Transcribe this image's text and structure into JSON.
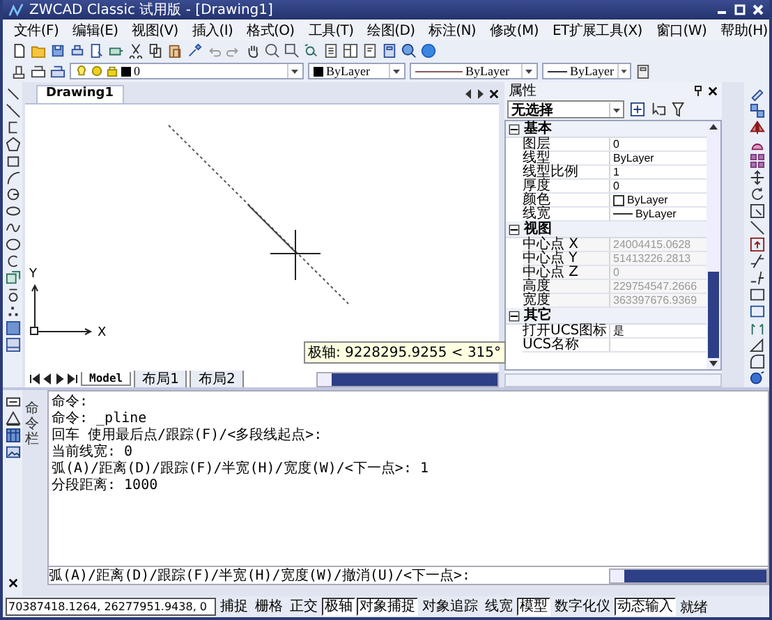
{
  "window": {
    "title": "ZWCAD Classic 试用版 - [Drawing1]"
  },
  "menu": [
    "文件(F)",
    "编辑(E)",
    "视图(V)",
    "插入(I)",
    "格式(O)",
    "工具(T)",
    "绘图(D)",
    "标注(N)",
    "修改(M)",
    "ET扩展工具(X)",
    "窗口(W)",
    "帮助(H)"
  ],
  "layer_toolbar": {
    "layer": "0",
    "color_control": "ByLayer",
    "linetype": "ByLayer",
    "lineweight": "ByLayer"
  },
  "document_tab": {
    "title": "Drawing1"
  },
  "drawing": {
    "tooltip": "极轴: 9228295.9255 < 315°",
    "ucs_x": "X",
    "ucs_y": "Y"
  },
  "layout_tabs": [
    {
      "label": "Model",
      "selected": true
    },
    {
      "label": "布局1",
      "selected": false
    },
    {
      "label": "布局2",
      "selected": false
    }
  ],
  "properties": {
    "title": "属性",
    "selection": "无选择",
    "groups": [
      {
        "name": "基本",
        "expanded": true,
        "rows": [
          {
            "name": "图层",
            "value": "0",
            "readonly": false,
            "kind": "text"
          },
          {
            "name": "线型",
            "value": "ByLayer",
            "readonly": false,
            "kind": "text"
          },
          {
            "name": "线型比例",
            "value": "1",
            "readonly": false,
            "kind": "text"
          },
          {
            "name": "厚度",
            "value": "0",
            "readonly": false,
            "kind": "text"
          },
          {
            "name": "颜色",
            "value": "ByLayer",
            "readonly": false,
            "kind": "color"
          },
          {
            "name": "线宽",
            "value": "ByLayer",
            "readonly": false,
            "kind": "lineweight"
          }
        ]
      },
      {
        "name": "视图",
        "expanded": true,
        "rows": [
          {
            "name": "中心点 X",
            "value": "24004415.0628",
            "readonly": true,
            "kind": "text"
          },
          {
            "name": "中心点 Y",
            "value": "51413226.2813",
            "readonly": true,
            "kind": "text"
          },
          {
            "name": "中心点 Z",
            "value": "0",
            "readonly": true,
            "kind": "text"
          },
          {
            "name": "高度",
            "value": "229754547.2666",
            "readonly": true,
            "kind": "text"
          },
          {
            "name": "宽度",
            "value": "363397676.9369",
            "readonly": true,
            "kind": "text"
          }
        ]
      },
      {
        "name": "其它",
        "expanded": true,
        "rows": [
          {
            "name": "打开UCS图标",
            "value": "是",
            "readonly": false,
            "kind": "text"
          },
          {
            "name": "UCS名称",
            "readonly": false,
            "kind": "text"
          }
        ]
      }
    ]
  },
  "command": {
    "title": "命令栏",
    "history": [
      "命令:",
      "命令: _pline",
      "回车 使用最后点/跟踪(F)/<多段线起点>:",
      "当前线宽: 0",
      "弧(A)/距离(D)/跟踪(F)/半宽(H)/宽度(W)/<下一点>: 1",
      "分段距离: 1000"
    ],
    "prompt": "弧(A)/距离(D)/跟踪(F)/半宽(H)/宽度(W)/撤消(U)/<下一点>:"
  },
  "status_bar": {
    "coordinates": "70387418.1264, 26277951.9438, 0",
    "buttons": [
      {
        "label": "捕捉",
        "on": false
      },
      {
        "label": "栅格",
        "on": false
      },
      {
        "label": "正交",
        "on": false
      },
      {
        "label": "极轴",
        "on": true
      },
      {
        "label": "对象捕捉",
        "on": true
      },
      {
        "label": "对象追踪",
        "on": false
      },
      {
        "label": "线宽",
        "on": false
      },
      {
        "label": "模型",
        "on": true
      },
      {
        "label": "数字化仪",
        "on": false
      },
      {
        "label": "动态输入",
        "on": true
      }
    ],
    "message": "就绪"
  }
}
